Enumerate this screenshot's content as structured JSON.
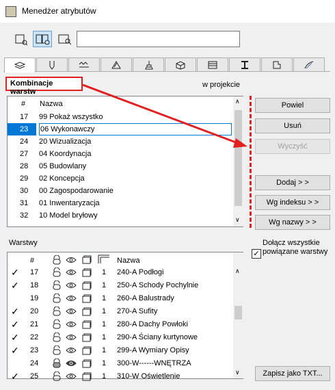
{
  "window": {
    "title": "Menedżer atrybutów"
  },
  "view_mode_icons": [
    "list-view-icon",
    "split-view-icon",
    "preview-view-icon"
  ],
  "search": {
    "value": ""
  },
  "tabs": [
    "layers-icon",
    "pen-icon",
    "line-type-icon",
    "fill-icon",
    "brush-icon",
    "building-material-icon",
    "composite-icon",
    "profile-icon",
    "zone-icon",
    "surface-icon"
  ],
  "combinations": {
    "title": "Kombinacje warstw",
    "mode_label": "w projekcie",
    "headers": {
      "num": "#",
      "name": "Nazwa"
    },
    "rows": [
      {
        "num": "17",
        "name": "99 Pokaż wszystko"
      },
      {
        "num": "23",
        "name": "06 Wykonawczy"
      },
      {
        "num": "24",
        "name": "20 Wizualizacja"
      },
      {
        "num": "27",
        "name": "04 Koordynacja"
      },
      {
        "num": "28",
        "name": "05 Budowlany"
      },
      {
        "num": "29",
        "name": "02 Koncepcja"
      },
      {
        "num": "30",
        "name": "00 Zagospodarowanie"
      },
      {
        "num": "31",
        "name": "01 Inwentaryzacja"
      },
      {
        "num": "32",
        "name": "10 Model bryłowy"
      }
    ]
  },
  "buttons": {
    "duplicate": "Powiel",
    "delete": "Usuń",
    "clear": "Wyczyść",
    "add": "Dodaj > >",
    "by_index": "Wg indeksu > >",
    "by_name": "Wg nazwy > >",
    "save_txt": "Zapisz jako TXT..."
  },
  "layers": {
    "title": "Warstwy",
    "headers": {
      "num": "#",
      "name": "Nazwa"
    },
    "rows": [
      {
        "checked": "✓",
        "num": "17",
        "hi": "1",
        "name": "240-A Podłogi"
      },
      {
        "checked": "✓",
        "num": "18",
        "hi": "1",
        "name": "250-A Schody Pochylnie"
      },
      {
        "checked": "",
        "num": "19",
        "hi": "1",
        "name": "260-A Balustrady"
      },
      {
        "checked": "✓",
        "num": "20",
        "hi": "1",
        "name": "270-A Sufity"
      },
      {
        "checked": "✓",
        "num": "21",
        "hi": "1",
        "name": "280-A Dachy Powłoki"
      },
      {
        "checked": "✓",
        "num": "22",
        "hi": "1",
        "name": "290-A Ściany kurtynowe"
      },
      {
        "checked": "✓",
        "num": "23",
        "hi": "1",
        "name": "299-A Wymiary Opisy"
      },
      {
        "checked": "",
        "num": "24",
        "hi": "1",
        "name": "300-W------WNĘTRZA"
      },
      {
        "checked": "✓",
        "num": "25",
        "hi": "1",
        "name": "310-W Oświetlenie"
      }
    ]
  },
  "include_all": {
    "label": "Dołącz wszystkie powiązane warstwy",
    "checked": true
  },
  "colors": {
    "selection": "#0078d7",
    "annotation_red": "#e32020"
  }
}
